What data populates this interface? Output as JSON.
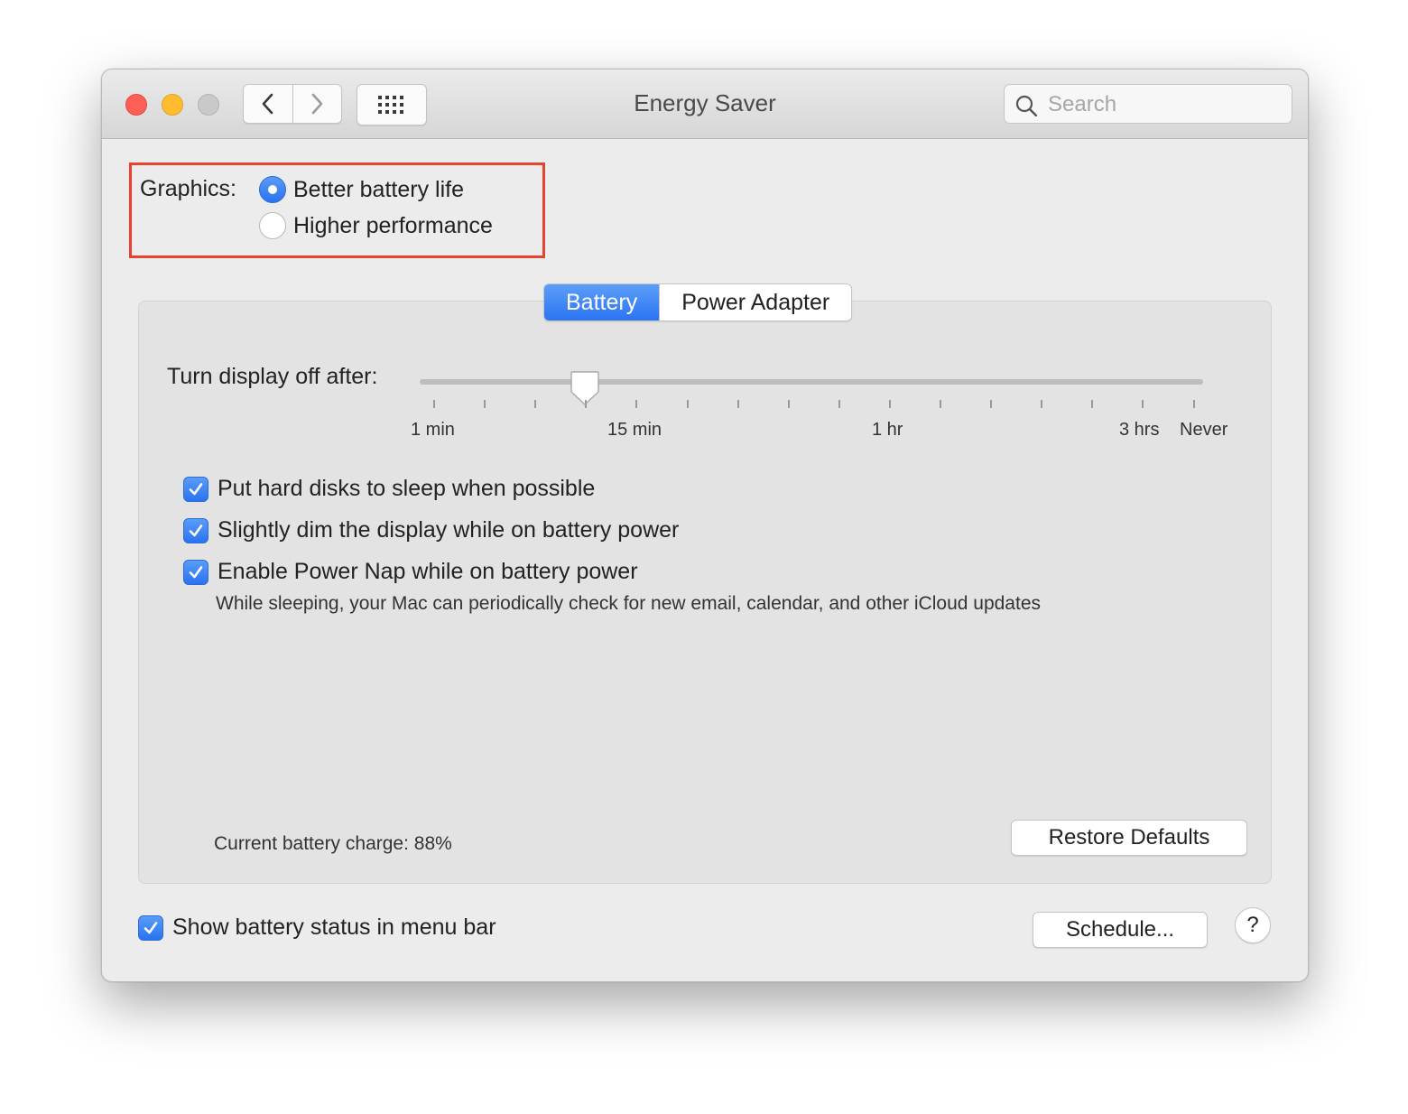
{
  "window": {
    "title": "Energy Saver"
  },
  "toolbar": {
    "back_icon": "chevron-left-icon",
    "forward_icon": "chevron-right-icon",
    "grid_icon": "grid-icon"
  },
  "search": {
    "placeholder": "Search",
    "value": ""
  },
  "graphics": {
    "label": "Graphics:",
    "options": [
      {
        "label": "Better battery life",
        "selected": true
      },
      {
        "label": "Higher performance",
        "selected": false
      }
    ],
    "highlight_color": "#e5432f"
  },
  "tabs": [
    {
      "label": "Battery",
      "active": true
    },
    {
      "label": "Power Adapter",
      "active": false
    }
  ],
  "display_off": {
    "label": "Turn display off after:",
    "tick_labels": [
      "1 min",
      "15 min",
      "1 hr",
      "3 hrs",
      "Never"
    ],
    "value": "15 min"
  },
  "options": [
    {
      "label": "Put hard disks to sleep when possible",
      "checked": true
    },
    {
      "label": "Slightly dim the display while on battery power",
      "checked": true
    },
    {
      "label": "Enable Power Nap while on battery power",
      "checked": true
    }
  ],
  "power_nap_description": "While sleeping, your Mac can periodically check for new email, calendar, and other iCloud updates",
  "battery_charge": "Current battery charge: 88%",
  "restore_defaults_label": "Restore Defaults",
  "footer": {
    "show_status_label": "Show battery status in menu bar",
    "show_status_checked": true,
    "schedule_label": "Schedule...",
    "help_label": "?"
  },
  "colors": {
    "accent": "#2b74f1",
    "close": "#fe5f57",
    "minimize": "#febc2e",
    "zoom_disabled": "#c9c9c9"
  }
}
